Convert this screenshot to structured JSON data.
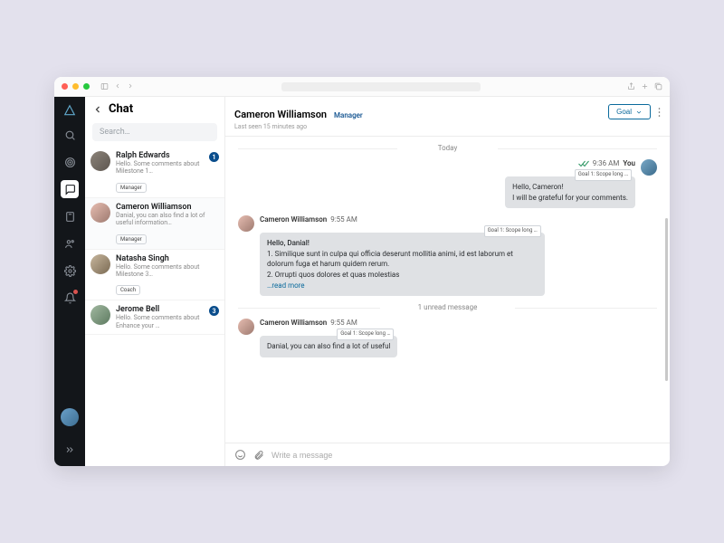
{
  "titlebar": {},
  "rail": {
    "items": [
      "search",
      "target",
      "chat",
      "notebook",
      "people",
      "settings",
      "bell"
    ],
    "active_index": 2
  },
  "page_title": "Chat",
  "search_placeholder": "Search…",
  "conversations": [
    {
      "name": "Ralph Edwards",
      "preview": "Hello. Some comments about Milestone 1…",
      "role": "Manager",
      "unread": 1
    },
    {
      "name": "Cameron Williamson",
      "preview": "Danial, you can also find a lot of useful information…",
      "role": "Manager",
      "unread": 0
    },
    {
      "name": "Natasha Singh",
      "preview": "Hello. Some comments about Milestone 3…",
      "role": "Coach",
      "unread": 0
    },
    {
      "name": "Jerome Bell",
      "preview": "Hello. Some comments about Enhance your …",
      "role": "",
      "unread": 3
    }
  ],
  "active_conversation_index": 1,
  "chat_header": {
    "name": "Cameron Williamson",
    "role": "Manager",
    "last_seen": "Last seen 15 minutes ago",
    "goal_button": "Goal"
  },
  "day_separator": "Today",
  "goal_chip_text": "Goal 1: Scope long …",
  "messages": [
    {
      "direction": "out",
      "author": "You",
      "time": "9:36 AM",
      "checks": true,
      "goal_chip": "Goal 1: Scope long …",
      "body_lines": [
        "Hello, Cameron!",
        "I will be grateful for your comments."
      ]
    },
    {
      "direction": "in",
      "author": "Cameron Williamson",
      "time": "9:55 AM",
      "goal_chip": "Goal 1: Scope long …",
      "body_lines": [
        "Hello, Danial!",
        "1. Similique sunt in culpa qui officia deserunt mollitia animi, id est laborum et dolorum fuga et harum quidem rerum.",
        "2. Orrupti quos dolores et quas molestias"
      ],
      "read_more": "…read more"
    },
    {
      "direction": "in",
      "author": "Cameron Williamson",
      "time": "9:55 AM",
      "goal_chip": "Goal 1: Scope long …",
      "body_lines": [
        "Danial, you can also find a lot of useful"
      ]
    }
  ],
  "unread_separator": "1 unread message",
  "composer_placeholder": "Write a message"
}
